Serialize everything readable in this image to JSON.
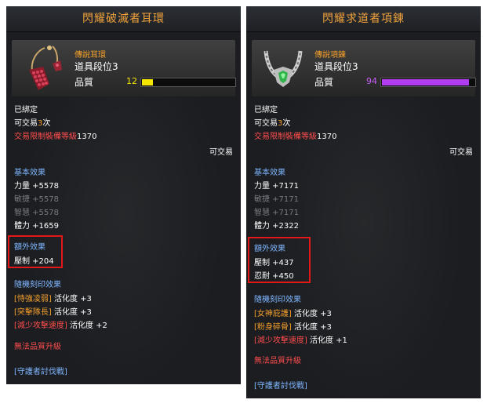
{
  "left": {
    "title": "閃耀破滅者耳環",
    "grade": "傳說耳環",
    "tier": "道具段位3",
    "quality_label": "品質",
    "quality_value": "12",
    "quality_fraction": 0.12,
    "quality_color": "#f5e400",
    "bound": "已綁定",
    "trade_prefix": "可交易",
    "trade_count": "3",
    "trade_suffix": "次",
    "limit_label": "交易限制裝備等級",
    "limit_value": "1370",
    "tradable": "可交易",
    "basic_header": "基本效果",
    "basic": [
      "力量 +5578",
      "敏捷 +5578",
      "智慧 +5578",
      "體力 +1659"
    ],
    "extra_header": "額外效果",
    "extra": [
      "壓制 +204"
    ],
    "rune_header": "隨機刻印效果",
    "runes": [
      {
        "name": "[恃強凌弱]",
        "tail": " 活化度 +3"
      },
      {
        "name": "[突擊隊長]",
        "tail": " 活化度 +3"
      },
      {
        "name": "[減少攻擊速度]",
        "tail": " 活化度 +2"
      }
    ],
    "no_upgrade": "無法品質升級",
    "source": "[守護者討伐戰]"
  },
  "right": {
    "title": "閃耀求道者項鍊",
    "grade": "傳說項鍊",
    "tier": "道具段位3",
    "quality_label": "品質",
    "quality_value": "94",
    "quality_fraction": 0.94,
    "quality_color": "#b23cf0",
    "bound": "已綁定",
    "trade_prefix": "可交易",
    "trade_count": "3",
    "trade_suffix": "次",
    "limit_label": "交易限制裝備等級",
    "limit_value": "1370",
    "tradable": "可交易",
    "basic_header": "基本效果",
    "basic": [
      "力量 +7171",
      "敏捷 +7171",
      "智慧 +7171",
      "體力 +2322"
    ],
    "extra_header": "額外效果",
    "extra": [
      "壓制 +437",
      "忍耐 +450"
    ],
    "rune_header": "隨機刻印效果",
    "runes": [
      {
        "name": "[女神庇護]",
        "tail": " 活化度 +3"
      },
      {
        "name": "[粉身碎骨]",
        "tail": " 活化度 +3"
      },
      {
        "name": "[減少攻擊速度]",
        "tail": " 活化度 +1"
      }
    ],
    "no_upgrade": "無法品質升級",
    "source": "[守護者討伐戰]"
  }
}
